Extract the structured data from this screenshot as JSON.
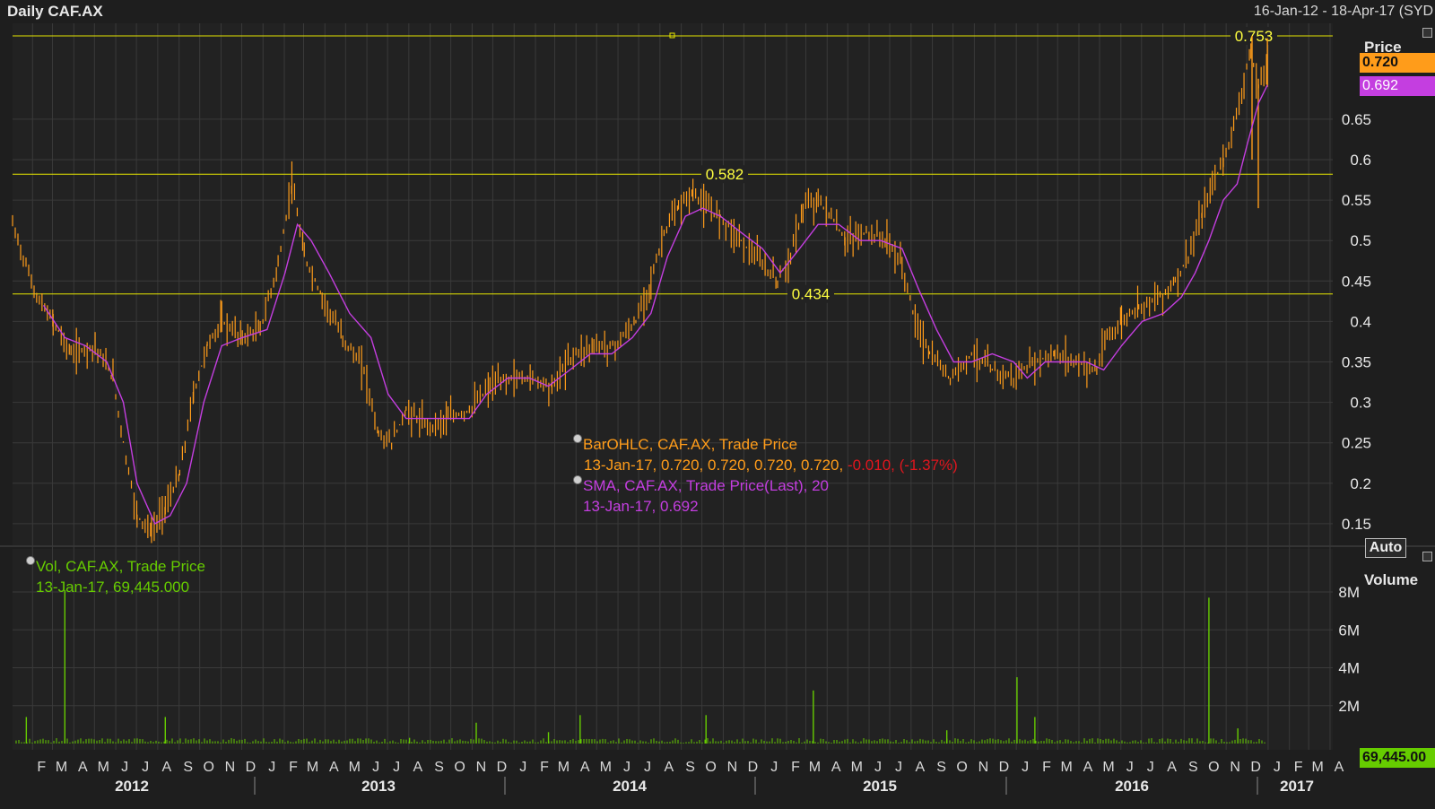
{
  "header": {
    "title": "Daily CAF.AX",
    "date_range": "16-Jan-12 - 18-Apr-17 (SYD"
  },
  "legend": {
    "ohlc_line1": "BarOHLC, CAF.AX, Trade Price",
    "ohlc_line2_values": "13-Jan-17, 0.720, 0.720, 0.720, 0.720,",
    "ohlc_line2_change": "-0.010, (-1.37%)",
    "sma_line1": "SMA, CAF.AX, Trade Price(Last),  20",
    "sma_line2": "13-Jan-17, 0.692",
    "vol_line1": "Vol, CAF.AX, Trade Price",
    "vol_line2": "13-Jan-17, 69,445.000"
  },
  "axes": {
    "price_title": "Price",
    "volume_title": "Volume",
    "auto_button": "Auto",
    "last_price_tag": "0.720",
    "sma_tag": "0.692",
    "volume_tag": "69,445.00"
  },
  "colors": {
    "price": "#ff9c1a",
    "sma": "#c43ee0",
    "volume": "#66cc00",
    "hline": "#e6e600",
    "background": "#1e1e1e",
    "grid": "#3a3a3a"
  },
  "chart_data": [
    {
      "type": "line",
      "title": "Daily CAF.AX",
      "ylabel": "Price",
      "ylim": [
        0.12,
        0.78
      ],
      "y_ticks": [
        "0.15",
        "0.2",
        "0.25",
        "0.3",
        "0.35",
        "0.4",
        "0.45",
        "0.5",
        "0.55",
        "0.6",
        "0.65"
      ],
      "x_start": "2012-01-16",
      "x_end": "2017-04-18",
      "month_labels": [
        "F",
        "M",
        "A",
        "M",
        "J",
        "J",
        "A",
        "S",
        "O",
        "N",
        "D",
        "J",
        "F",
        "M",
        "A",
        "M",
        "J",
        "J",
        "A",
        "S",
        "O",
        "N",
        "D",
        "J",
        "F",
        "M",
        "A",
        "M",
        "J",
        "J",
        "A",
        "S",
        "O",
        "N",
        "D",
        "J",
        "F",
        "M",
        "A",
        "M",
        "J",
        "J",
        "A",
        "S",
        "O",
        "N",
        "D",
        "J",
        "F",
        "M",
        "A",
        "M",
        "J",
        "J",
        "A",
        "S",
        "O",
        "N",
        "D",
        "J",
        "F",
        "M",
        "A"
      ],
      "year_labels": [
        "2012",
        "2013",
        "2014",
        "2015",
        "2016",
        "2017"
      ],
      "horizontal_lines": [
        {
          "value": 0.753,
          "label": "0.753"
        },
        {
          "value": 0.582,
          "label": "0.582"
        },
        {
          "value": 0.434,
          "label": "0.434"
        }
      ],
      "series": [
        {
          "name": "BarOHLC, CAF.AX, Trade Price",
          "points": [
            [
              "2012-01-16",
              0.52
            ],
            [
              "2012-02-20",
              0.43
            ],
            [
              "2012-03-15",
              0.4
            ],
            [
              "2012-04-10",
              0.36
            ],
            [
              "2012-05-15",
              0.37
            ],
            [
              "2012-06-10",
              0.33
            ],
            [
              "2012-06-25",
              0.25
            ],
            [
              "2012-07-15",
              0.16
            ],
            [
              "2012-08-05",
              0.14
            ],
            [
              "2012-08-25",
              0.17
            ],
            [
              "2012-09-15",
              0.21
            ],
            [
              "2012-10-05",
              0.31
            ],
            [
              "2012-10-25",
              0.37
            ],
            [
              "2012-11-15",
              0.4
            ],
            [
              "2012-12-15",
              0.38
            ],
            [
              "2013-01-10",
              0.39
            ],
            [
              "2013-02-05",
              0.47
            ],
            [
              "2013-02-25",
              0.57
            ],
            [
              "2013-03-15",
              0.48
            ],
            [
              "2013-04-10",
              0.43
            ],
            [
              "2013-05-10",
              0.38
            ],
            [
              "2013-06-10",
              0.34
            ],
            [
              "2013-07-01",
              0.26
            ],
            [
              "2013-07-20",
              0.25
            ],
            [
              "2013-08-10",
              0.29
            ],
            [
              "2013-09-10",
              0.27
            ],
            [
              "2013-10-10",
              0.28
            ],
            [
              "2013-11-10",
              0.29
            ],
            [
              "2013-12-10",
              0.32
            ],
            [
              "2014-01-10",
              0.33
            ],
            [
              "2014-02-10",
              0.33
            ],
            [
              "2014-03-10",
              0.32
            ],
            [
              "2014-04-10",
              0.36
            ],
            [
              "2014-05-10",
              0.37
            ],
            [
              "2014-06-10",
              0.37
            ],
            [
              "2014-07-10",
              0.4
            ],
            [
              "2014-08-01",
              0.45
            ],
            [
              "2014-08-20",
              0.51
            ],
            [
              "2014-09-10",
              0.54
            ],
            [
              "2014-10-01",
              0.56
            ],
            [
              "2014-10-20",
              0.54
            ],
            [
              "2014-11-10",
              0.53
            ],
            [
              "2014-12-10",
              0.5
            ],
            [
              "2015-01-10",
              0.47
            ],
            [
              "2015-02-01",
              0.45
            ],
            [
              "2015-02-20",
              0.48
            ],
            [
              "2015-03-10",
              0.54
            ],
            [
              "2015-04-01",
              0.55
            ],
            [
              "2015-04-20",
              0.53
            ],
            [
              "2015-05-10",
              0.5
            ],
            [
              "2015-06-10",
              0.51
            ],
            [
              "2015-07-10",
              0.5
            ],
            [
              "2015-08-01",
              0.47
            ],
            [
              "2015-08-20",
              0.4
            ],
            [
              "2015-09-10",
              0.36
            ],
            [
              "2015-10-10",
              0.33
            ],
            [
              "2015-11-10",
              0.36
            ],
            [
              "2015-12-10",
              0.34
            ],
            [
              "2016-01-10",
              0.33
            ],
            [
              "2016-02-10",
              0.35
            ],
            [
              "2016-03-10",
              0.36
            ],
            [
              "2016-04-10",
              0.35
            ],
            [
              "2016-05-10",
              0.34
            ],
            [
              "2016-05-25",
              0.38
            ],
            [
              "2016-06-15",
              0.4
            ],
            [
              "2016-07-10",
              0.42
            ],
            [
              "2016-08-10",
              0.43
            ],
            [
              "2016-09-01",
              0.45
            ],
            [
              "2016-09-20",
              0.48
            ],
            [
              "2016-10-10",
              0.53
            ],
            [
              "2016-10-25",
              0.57
            ],
            [
              "2016-11-10",
              0.6
            ],
            [
              "2016-11-25",
              0.64
            ],
            [
              "2016-12-10",
              0.7
            ],
            [
              "2016-12-20",
              0.73
            ],
            [
              "2016-12-31",
              0.69
            ],
            [
              "2017-01-13",
              0.72
            ]
          ]
        },
        {
          "name": "SMA, CAF.AX, Trade Price(Last),  20",
          "points": [
            [
              "2012-03-01",
              0.42
            ],
            [
              "2012-04-01",
              0.38
            ],
            [
              "2012-05-01",
              0.37
            ],
            [
              "2012-06-01",
              0.35
            ],
            [
              "2012-06-25",
              0.3
            ],
            [
              "2012-07-15",
              0.2
            ],
            [
              "2012-08-10",
              0.15
            ],
            [
              "2012-09-01",
              0.16
            ],
            [
              "2012-09-25",
              0.2
            ],
            [
              "2012-10-20",
              0.3
            ],
            [
              "2012-11-15",
              0.37
            ],
            [
              "2012-12-15",
              0.38
            ],
            [
              "2013-01-20",
              0.39
            ],
            [
              "2013-02-15",
              0.46
            ],
            [
              "2013-03-05",
              0.52
            ],
            [
              "2013-03-25",
              0.5
            ],
            [
              "2013-04-20",
              0.46
            ],
            [
              "2013-05-20",
              0.41
            ],
            [
              "2013-06-20",
              0.38
            ],
            [
              "2013-07-15",
              0.31
            ],
            [
              "2013-08-10",
              0.28
            ],
            [
              "2013-09-10",
              0.28
            ],
            [
              "2013-10-10",
              0.28
            ],
            [
              "2013-11-10",
              0.28
            ],
            [
              "2013-12-05",
              0.31
            ],
            [
              "2014-01-05",
              0.33
            ],
            [
              "2014-02-05",
              0.33
            ],
            [
              "2014-03-05",
              0.32
            ],
            [
              "2014-04-05",
              0.34
            ],
            [
              "2014-05-05",
              0.36
            ],
            [
              "2014-06-05",
              0.36
            ],
            [
              "2014-07-05",
              0.38
            ],
            [
              "2014-08-01",
              0.41
            ],
            [
              "2014-08-25",
              0.48
            ],
            [
              "2014-09-20",
              0.53
            ],
            [
              "2014-10-15",
              0.54
            ],
            [
              "2014-11-10",
              0.53
            ],
            [
              "2014-12-10",
              0.51
            ],
            [
              "2015-01-10",
              0.49
            ],
            [
              "2015-02-05",
              0.46
            ],
            [
              "2015-03-05",
              0.49
            ],
            [
              "2015-04-01",
              0.52
            ],
            [
              "2015-05-01",
              0.52
            ],
            [
              "2015-06-01",
              0.5
            ],
            [
              "2015-07-01",
              0.5
            ],
            [
              "2015-08-01",
              0.49
            ],
            [
              "2015-08-25",
              0.44
            ],
            [
              "2015-09-20",
              0.39
            ],
            [
              "2015-10-15",
              0.35
            ],
            [
              "2015-11-10",
              0.35
            ],
            [
              "2015-12-10",
              0.36
            ],
            [
              "2016-01-10",
              0.35
            ],
            [
              "2016-01-30",
              0.33
            ],
            [
              "2016-02-25",
              0.35
            ],
            [
              "2016-03-25",
              0.35
            ],
            [
              "2016-04-25",
              0.35
            ],
            [
              "2016-05-20",
              0.34
            ],
            [
              "2016-06-15",
              0.37
            ],
            [
              "2016-07-15",
              0.4
            ],
            [
              "2016-08-15",
              0.41
            ],
            [
              "2016-09-10",
              0.43
            ],
            [
              "2016-09-30",
              0.46
            ],
            [
              "2016-10-20",
              0.5
            ],
            [
              "2016-11-10",
              0.55
            ],
            [
              "2016-11-30",
              0.57
            ],
            [
              "2016-12-15",
              0.62
            ],
            [
              "2016-12-31",
              0.67
            ],
            [
              "2017-01-13",
              0.692
            ]
          ]
        }
      ]
    },
    {
      "type": "bar",
      "title": "Vol, CAF.AX, Trade Price",
      "ylabel": "Volume",
      "ylim": [
        0,
        9000000
      ],
      "y_ticks": [
        "2M",
        "4M",
        "6M",
        "8M"
      ],
      "series": [
        {
          "name": "Vol, CAF.AX, Trade Price",
          "points": [
            [
              "2012-02-05",
              1400000
            ],
            [
              "2012-04-01",
              8100000
            ],
            [
              "2012-08-25",
              1400000
            ],
            [
              "2013-08-15",
              300000
            ],
            [
              "2013-11-20",
              1100000
            ],
            [
              "2014-03-05",
              600000
            ],
            [
              "2014-04-20",
              1500000
            ],
            [
              "2014-10-20",
              1500000
            ],
            [
              "2015-03-25",
              2800000
            ],
            [
              "2015-10-05",
              700000
            ],
            [
              "2016-01-15",
              3500000
            ],
            [
              "2016-02-10",
              1400000
            ],
            [
              "2016-10-20",
              7700000
            ],
            [
              "2016-12-01",
              800000
            ]
          ]
        }
      ]
    }
  ]
}
